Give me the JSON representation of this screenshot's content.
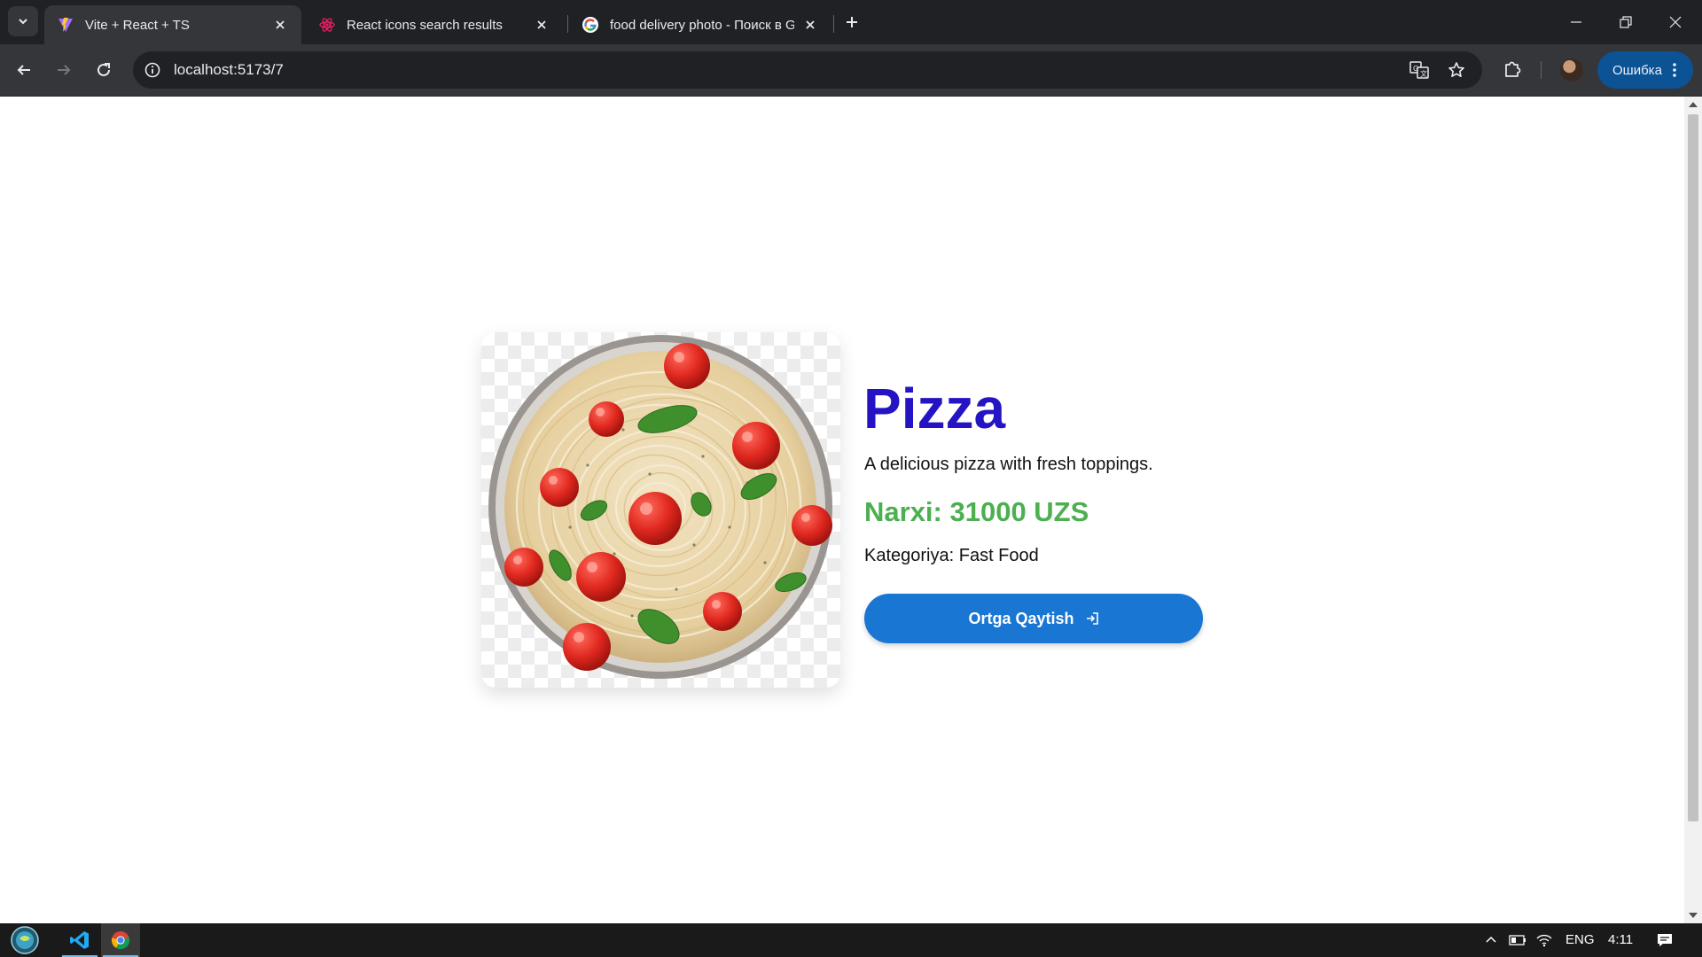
{
  "browser": {
    "tabs": [
      {
        "title": "Vite + React + TS",
        "active": true,
        "favicon": "vite-favicon-icon"
      },
      {
        "title": "React icons search results",
        "active": false,
        "favicon": "react-favicon-icon"
      },
      {
        "title": "food delivery photo - Поиск в G",
        "active": false,
        "favicon": "google-favicon-icon"
      }
    ],
    "address": "localhost:5173/7",
    "profile_status": "Ошибка"
  },
  "product": {
    "title": "Pizza",
    "description": "A delicious pizza with fresh toppings.",
    "price_text": "Narxi: 31000 UZS",
    "category_text": "Kategoriya: Fast Food",
    "back_button_label": "Ortga Qaytish",
    "image_subject": "spaghetti-with-tomatoes-photo"
  },
  "taskbar": {
    "language": "ENG",
    "time": "4:11",
    "apps": [
      "start-orb-icon",
      "vscode-icon",
      "chrome-icon"
    ]
  },
  "colors": {
    "title": "#2414c4",
    "price": "#4caf50",
    "button": "#1976d2",
    "chrome_dark": "#202124",
    "chrome_toolbar": "#35363a"
  }
}
